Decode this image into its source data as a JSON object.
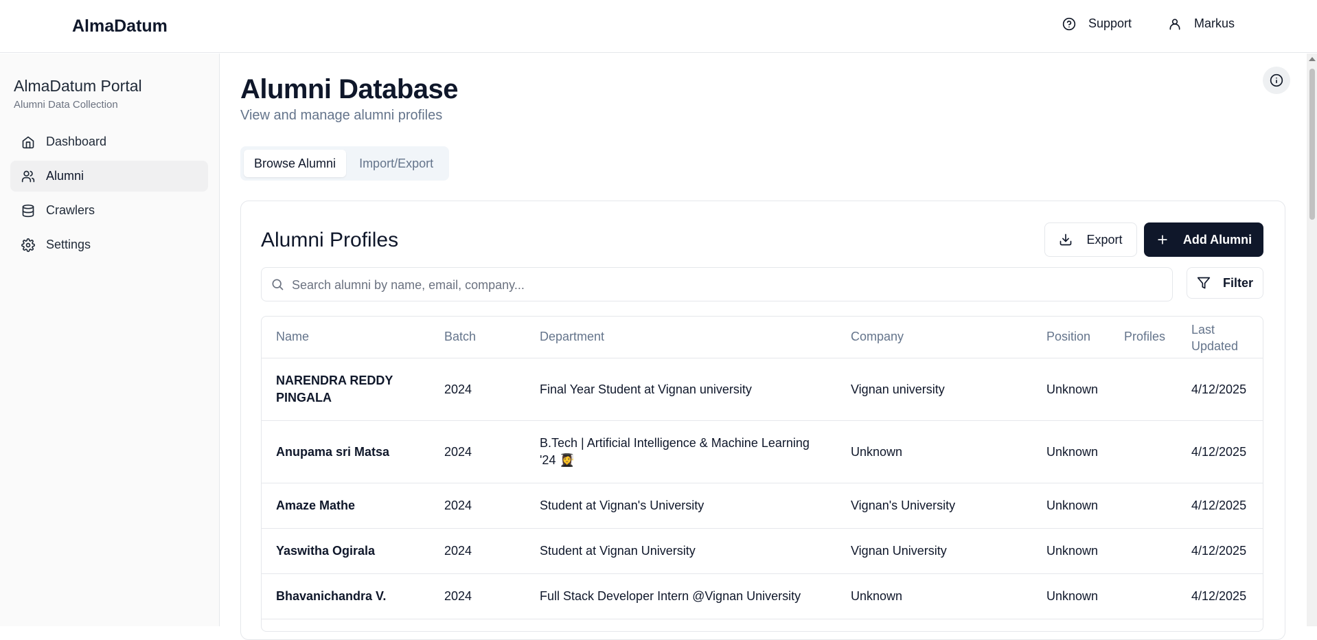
{
  "app": {
    "brand": "AlmaDatum",
    "support_label": "Support",
    "user_label": "Markus"
  },
  "sidebar": {
    "title": "AlmaDatum Portal",
    "subtitle": "Alumni Data Collection",
    "items": [
      {
        "label": "Dashboard",
        "icon": "home-icon",
        "active": false
      },
      {
        "label": "Alumni",
        "icon": "users-icon",
        "active": true
      },
      {
        "label": "Crawlers",
        "icon": "database-icon",
        "active": false
      },
      {
        "label": "Settings",
        "icon": "gear-icon",
        "active": false
      }
    ]
  },
  "main": {
    "title": "Alumni Database",
    "subtitle": "View and manage alumni profiles",
    "tabs": [
      {
        "label": "Browse Alumni",
        "active": true
      },
      {
        "label": "Import/Export",
        "active": false
      }
    ],
    "card": {
      "title": "Alumni Profiles",
      "export_label": "Export",
      "add_label": "Add Alumni",
      "filter_label": "Filter",
      "search_placeholder": "Search alumni by name, email, company..."
    },
    "table": {
      "columns": [
        "Name",
        "Batch",
        "Department",
        "Company",
        "Position",
        "Profiles",
        "Last Updated"
      ],
      "rows": [
        {
          "name": "NARENDRA REDDY PINGALA",
          "batch": "2024",
          "department": "Final Year Student at Vignan university",
          "company": "Vignan university",
          "position": "Unknown",
          "profiles": "",
          "updated": "4/12/2025"
        },
        {
          "name": "Anupama sri Matsa",
          "batch": "2024",
          "department": "B.Tech | Artificial Intelligence & Machine Learning '24 👩‍🎓",
          "company": "Unknown",
          "position": "Unknown",
          "profiles": "",
          "updated": "4/12/2025"
        },
        {
          "name": "Amaze Mathe",
          "batch": "2024",
          "department": "Student at Vignan's University",
          "company": "Vignan's University",
          "position": "Unknown",
          "profiles": "",
          "updated": "4/12/2025"
        },
        {
          "name": "Yaswitha Ogirala",
          "batch": "2024",
          "department": "Student at Vignan University",
          "company": "Vignan University",
          "position": "Unknown",
          "profiles": "",
          "updated": "4/12/2025"
        },
        {
          "name": "Bhavanichandra V.",
          "batch": "2024",
          "department": "Full Stack Developer Intern @Vignan University",
          "company": "Unknown",
          "position": "Unknown",
          "profiles": "",
          "updated": "4/12/2025"
        }
      ]
    }
  },
  "colors": {
    "primary": "#0f172a",
    "muted": "#64748b",
    "border": "#e5e7eb",
    "sidebar_bg": "#fafafa",
    "active_bg": "#f0f0f1"
  }
}
